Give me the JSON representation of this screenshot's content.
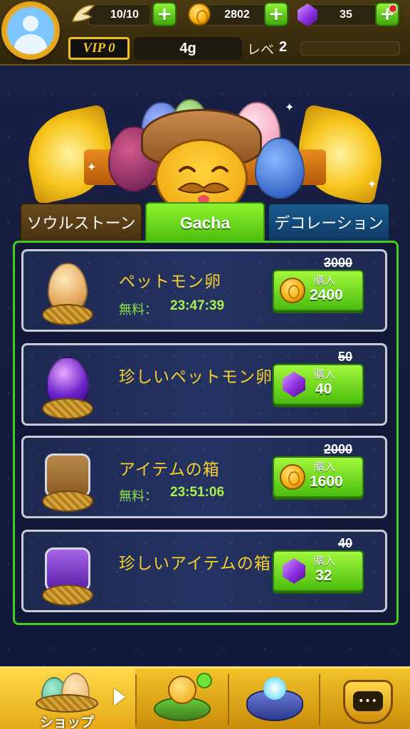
{
  "header": {
    "energy": "10/10",
    "coins": "2802",
    "gems": "35",
    "vip_label": "VIP 0",
    "gold": "4g",
    "level_label": "レベ",
    "level_value": "2"
  },
  "tabs": [
    {
      "label": "ソウルストーン"
    },
    {
      "label": "Gacha"
    },
    {
      "label": "デコレーション"
    }
  ],
  "shop_items": [
    {
      "title": "ペットモン卵",
      "free_label": "無料：",
      "timer": "23:47:39",
      "old_price": "3000",
      "buy_label": "購入",
      "price": "2400",
      "currency": "coin"
    },
    {
      "title": "珍しいペットモン卵",
      "old_price": "50",
      "buy_label": "購入",
      "price": "40",
      "currency": "gem"
    },
    {
      "title": "アイテムの箱",
      "free_label": "無料：",
      "timer": "23:51:06",
      "old_price": "2000",
      "buy_label": "購入",
      "price": "1600",
      "currency": "coin"
    },
    {
      "title": "珍しいアイテムの箱",
      "old_price": "40",
      "buy_label": "購入",
      "price": "32",
      "currency": "gem"
    }
  ],
  "bottom_nav": {
    "shop_label": "ショップ"
  },
  "colors": {
    "accent_green": "#4dbd0f",
    "title_yellow": "#f7cf2d",
    "timer_green": "#a9f04c"
  }
}
